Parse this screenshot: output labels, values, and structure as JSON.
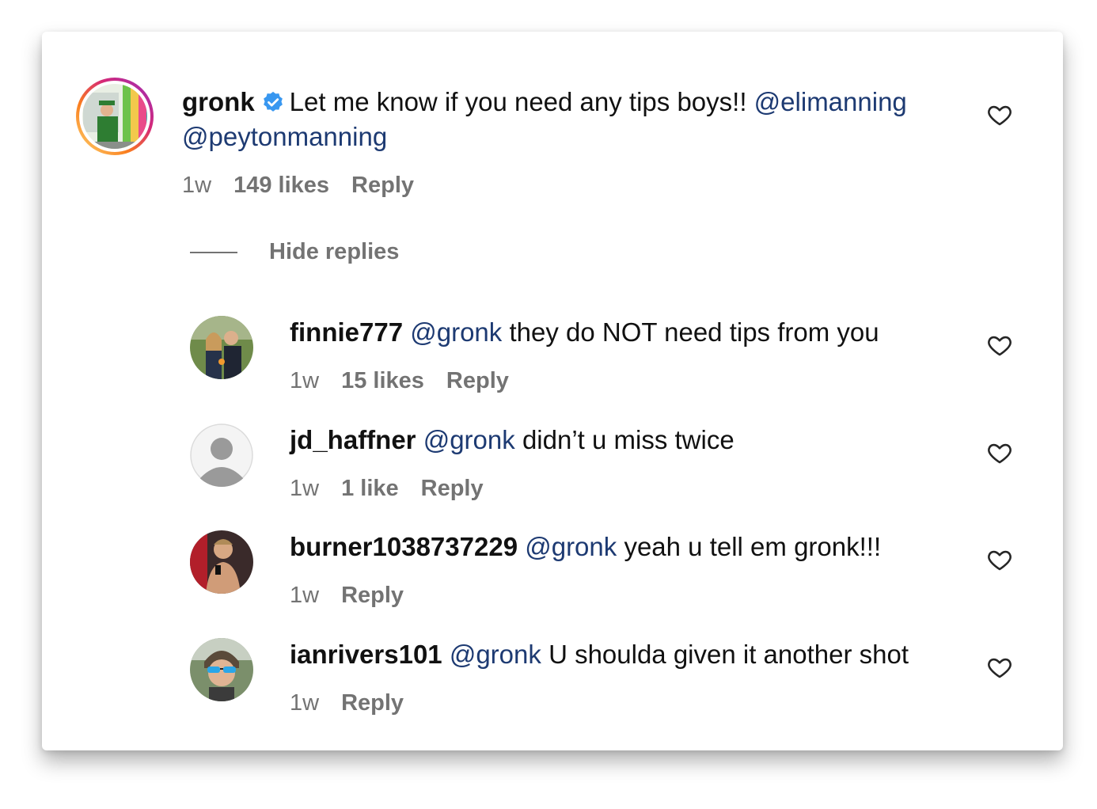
{
  "main_comment": {
    "username": "gronk",
    "verified": true,
    "text": "Let me know if you need any tips boys!!",
    "mention_1": "@elimanning",
    "mention_2": "@peytonmanning",
    "time": "1w",
    "likes": "149 likes",
    "reply_label": "Reply",
    "avatar_icon": "profile-photo-icon"
  },
  "hide_replies_label": "Hide replies",
  "replies": [
    {
      "username": "finnie777",
      "mention": "@gronk",
      "text": "they do NOT need tips from you",
      "time": "1w",
      "likes": "15 likes",
      "reply_label": "Reply"
    },
    {
      "username": "jd_haffner",
      "mention": "@gronk",
      "text": "didn’t u miss twice",
      "time": "1w",
      "likes": "1 like",
      "reply_label": "Reply"
    },
    {
      "username": "burner1038737229",
      "mention": "@gronk",
      "text": "yeah u tell em gronk!!!",
      "time": "1w",
      "reply_label": "Reply"
    },
    {
      "username": "ianrivers101",
      "mention": "@gronk",
      "text": "U shoulda given it another shot",
      "time": "1w",
      "reply_label": "Reply"
    }
  ],
  "colors": {
    "mention": "#1d3a72",
    "meta_gray": "#737373",
    "verified_blue": "#3897f0"
  }
}
